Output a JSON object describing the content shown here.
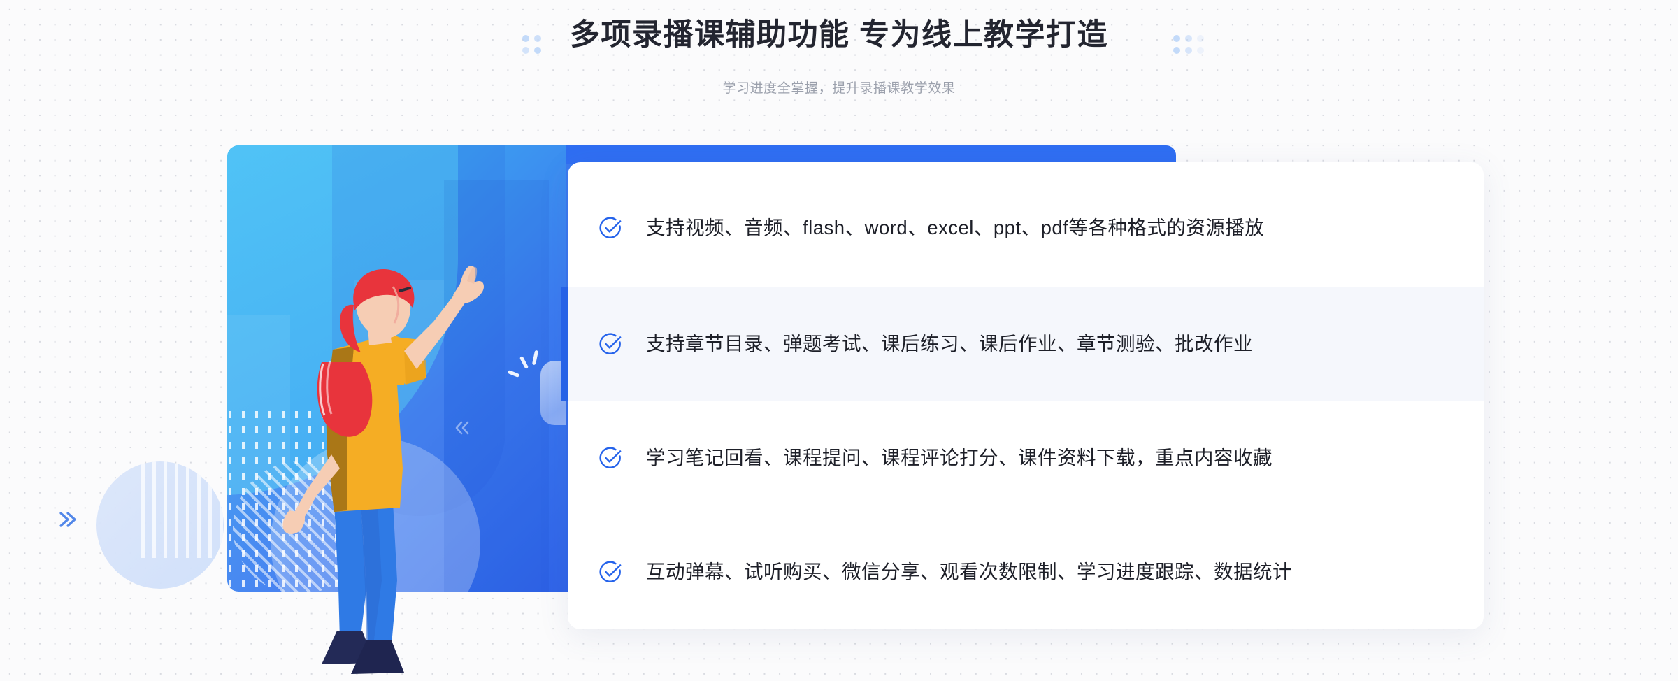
{
  "header": {
    "title": "多项录播课辅助功能 专为线上教学打造",
    "subtitle": "学习进度全掌握，提升录播课教学效果"
  },
  "illustration": {
    "alt_label": "插画：女性指向播放按钮",
    "play_icon": "play-icon",
    "bubble_icon": "speech-bubble-icon",
    "chevron_icon": "chevron-double-left-icon",
    "outer_chevron_icon": "chevron-double-right-icon"
  },
  "features": {
    "check_icon": "check-circle-icon",
    "items": [
      {
        "text": "支持视频、音频、flash、word、excel、ppt、pdf等各种格式的资源播放",
        "highlighted": false
      },
      {
        "text": "支持章节目录、弹题考试、课后练习、课后作业、章节测验、批改作业",
        "highlighted": true
      },
      {
        "text": "学习笔记回看、课程提问、课程评论打分、课件资料下载，重点内容收藏",
        "highlighted": false
      },
      {
        "text": "互动弹幕、试听购买、微信分享、观看次数限制、学习进度跟踪、数据统计",
        "highlighted": false
      }
    ]
  },
  "colors": {
    "page_background": "#fbfbfc",
    "dot_grid": "#d9dbe1",
    "accent_blue": "#2563eb",
    "panel_blue_light": "#3fc0f5",
    "panel_blue_dark": "#2f63e8",
    "title_text": "#232530",
    "subtitle_text": "#9ba0ac",
    "body_text": "#1d1f28",
    "row_highlight": "#f5f7fc",
    "shirt_yellow": "#f5ad24",
    "hair_red": "#e8343c",
    "pants_blue": "#2f7ae5",
    "shoe_navy": "#232a57",
    "skin": "#f6cdb4"
  }
}
